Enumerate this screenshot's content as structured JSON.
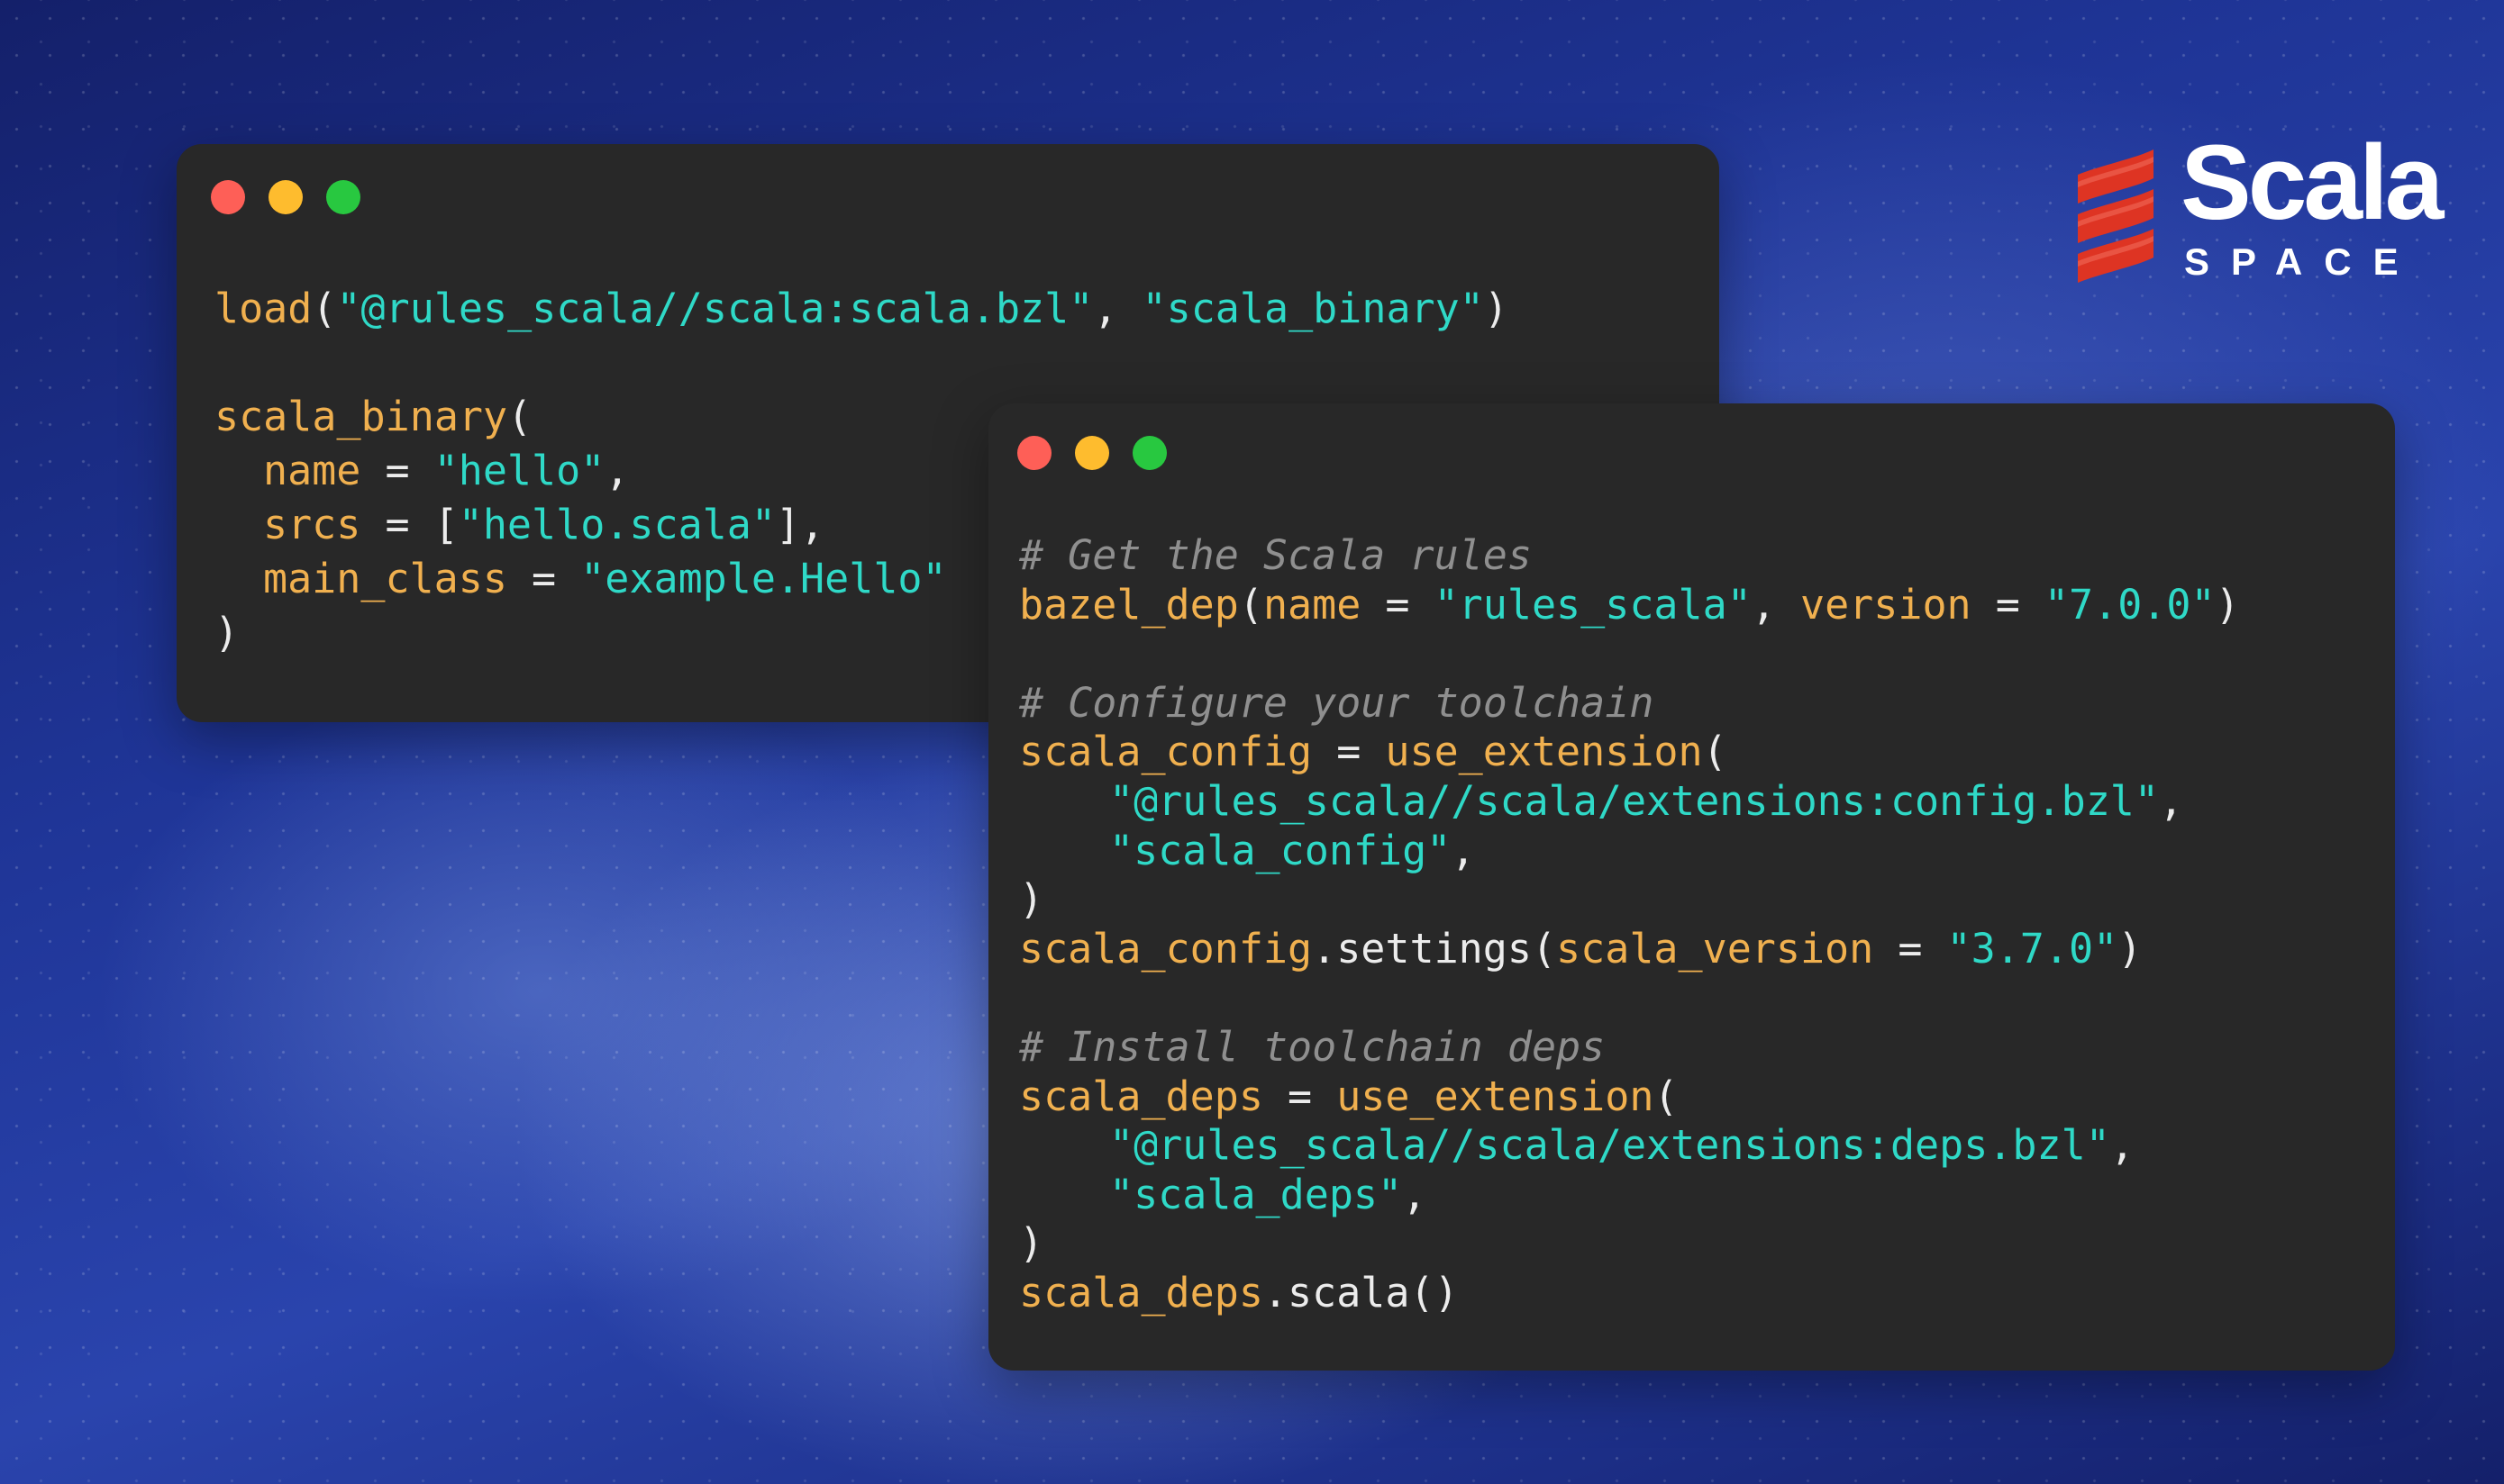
{
  "colors": {
    "window_bg": "#282828",
    "keyword_orange": "#f0b04f",
    "string_teal": "#2fd9c7",
    "comment_gray": "#8f8f8f",
    "dot_red": "#fe5f57",
    "dot_yellow": "#febc2e",
    "dot_green": "#28c840",
    "logo_red": "#de3423"
  },
  "logo": {
    "icon": "scala-logo-icon",
    "wordmark": "Scala",
    "subtitle": "SPACE"
  },
  "back_window": {
    "controls": [
      "close",
      "minimize",
      "zoom"
    ],
    "code": {
      "l1_fn": "load",
      "l1_p1": "(",
      "l1_s1": "\"@rules_scala//scala:scala.bzl\"",
      "l1_p2": ", ",
      "l1_s2": "\"scala_binary\"",
      "l1_p3": ")",
      "l3_fn": "scala_binary",
      "l3_p": "(",
      "l4_k": "name",
      "l4_op": " = ",
      "l4_s": "\"hello\"",
      "l4_p": ",",
      "l5_k": "srcs",
      "l5_op": " = [",
      "l5_s": "\"hello.scala\"",
      "l5_p": "],",
      "l6_k": "main_class",
      "l6_op": " = ",
      "l6_s": "\"example.Hello\"",
      "l7_p": ")"
    }
  },
  "front_window": {
    "controls": [
      "close",
      "minimize",
      "zoom"
    ],
    "code": {
      "c1": "# Get the Scala rules",
      "b_fn": "bazel_dep",
      "b_p1": "(",
      "b_k1": "name",
      "b_op1": " = ",
      "b_s1": "\"rules_scala\"",
      "b_p2": ", ",
      "b_k2": "version",
      "b_op2": " = ",
      "b_s2": "\"7.0.0\"",
      "b_p3": ")",
      "c2": "# Configure your toolchain",
      "sc_v": "scala_config",
      "sc_op": " = ",
      "sc_fn": "use_extension",
      "sc_p": "(",
      "sc_s1": "\"@rules_scala//scala/extensions:config.bzl\"",
      "sc_s1p": ",",
      "sc_s2": "\"scala_config\"",
      "sc_s2p": ",",
      "sc_close": ")",
      "ss_v": "scala_config",
      "ss_m": ".settings(",
      "ss_k": "scala_version",
      "ss_op": " = ",
      "ss_s": "\"3.7.0\"",
      "ss_p": ")",
      "c3": "# Install toolchain deps",
      "sd_v": "scala_deps",
      "sd_op": " = ",
      "sd_fn": "use_extension",
      "sd_p": "(",
      "sd_s1": "\"@rules_scala//scala/extensions:deps.bzl\"",
      "sd_s1p": ",",
      "sd_s2": "\"scala_deps\"",
      "sd_s2p": ",",
      "sd_close": ")",
      "sdc_v": "scala_deps",
      "sdc_m": ".scala()"
    }
  }
}
